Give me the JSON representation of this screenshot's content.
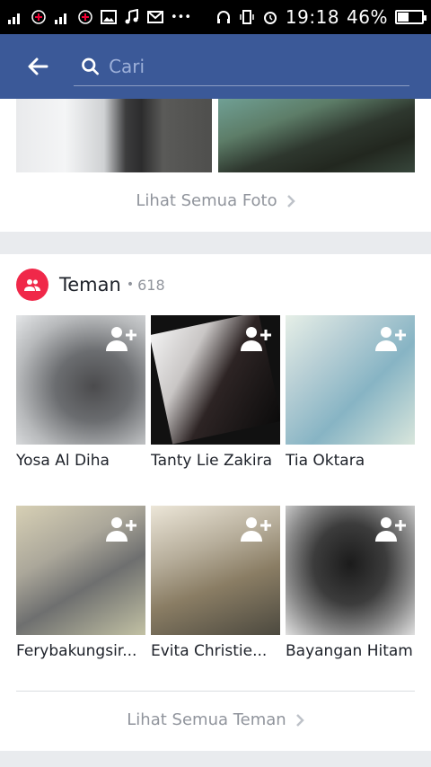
{
  "status_bar": {
    "time": "19:18",
    "battery_percent": "46%",
    "battery_level": 0.46,
    "icons": [
      "signal-icon",
      "data-icon",
      "signal-icon",
      "data-icon",
      "image-icon",
      "music-icon",
      "mail-icon",
      "more-icon",
      "headset-icon",
      "vibrate-icon",
      "alarm-icon",
      "battery-icon"
    ]
  },
  "app_bar": {
    "search_placeholder": "Cari"
  },
  "photos": {
    "see_all_label": "Lihat Semua Foto"
  },
  "friends": {
    "title": "Teman",
    "count": "618",
    "items": [
      {
        "name": "Yosa Al Diha"
      },
      {
        "name": "Tanty Lie Zakira"
      },
      {
        "name": "Tia Oktara"
      },
      {
        "name": "Ferybakungsir..."
      },
      {
        "name": "Evita Christie..."
      },
      {
        "name": "Bayangan Hitam"
      }
    ],
    "see_all_label": "Lihat Semua Teman"
  },
  "colors": {
    "brand": "#3b5998",
    "friends_icon_bg": "#f02849",
    "link_gray": "#90949c"
  }
}
